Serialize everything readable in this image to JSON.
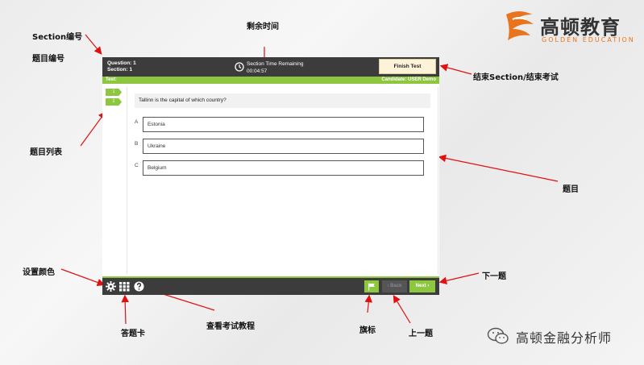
{
  "annotations": {
    "section_number": "Section编号",
    "question_number": "题目编号",
    "time_remaining": "剩余时间",
    "finish_section": "结束Section/结束考试",
    "question_list": "题目列表",
    "question": "题目",
    "set_color": "设置颜色",
    "next": "下一题",
    "answer_card": "答题卡",
    "view_tutorial": "查看考试教程",
    "flag": "旗标",
    "previous": "上一题"
  },
  "logo": {
    "name_cn": "高顿教育",
    "name_en": "GOLDEN EDUCATION",
    "brand_color": "#e8741e"
  },
  "exam": {
    "question_label": "Question: 1",
    "section_label": "Section: 1",
    "timer_label": "Section Time Remaining",
    "timer_value": "00:04:57",
    "finish_button": "Finish Test",
    "test_label": "Test:",
    "candidate_label": "Candidate: USER Demo",
    "question_tabs": [
      "1",
      "2"
    ],
    "question_text": "Tallinn is the capital of which country?",
    "options": [
      {
        "letter": "A",
        "text": "Estonia"
      },
      {
        "letter": "B",
        "text": "Ukraine"
      },
      {
        "letter": "C",
        "text": "Belgium"
      }
    ],
    "back_button": "‹ Back",
    "next_button": "Next ›",
    "accent_color": "#8dc63f",
    "bar_color": "#3c3c3c"
  },
  "icons": {
    "settings": "gear-icon",
    "answer_card": "grid-icon",
    "help": "question-circle-icon",
    "flag": "flag-icon",
    "timer": "clock-icon"
  },
  "watermark": {
    "text": "高顿金融分析师"
  }
}
